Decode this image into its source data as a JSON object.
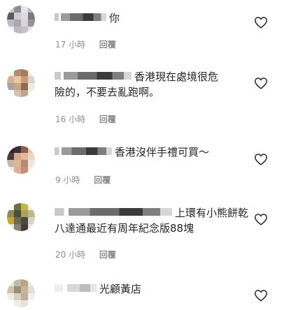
{
  "comments": [
    {
      "text": "你",
      "time": "17 小時",
      "reply": "回覆",
      "avatar": [
        "#c9c7cb",
        "#8e8d96",
        "#e6e4e8",
        "#b7b5bb",
        "#5b5a63",
        "#cfcdd2",
        "#dcdadf",
        "#7a7982",
        "#bdbbc1",
        "#a9a7ad",
        "#d7d5da",
        "#94939a",
        "#eeedf0",
        "#bcbac0",
        "#c4c2c7",
        "#e0dfe3"
      ]
    },
    {
      "text": "香港現在處境很危\n險的，不要去亂跑啊。",
      "time": "16 小時",
      "reply": "回覆",
      "avatar": [
        "#f2efe9",
        "#b68c6f",
        "#a77a5b",
        "#efeae3",
        "#d6b193",
        "#e8c6a6",
        "#c79c7a",
        "#dad3cb",
        "#a9a2a0",
        "#caa584",
        "#8f6b53",
        "#efe9e3",
        "#ffffff",
        "#d3c2b2",
        "#bca58f",
        "#f6f2ee"
      ]
    },
    {
      "text": "香港沒伴手禮可買～",
      "time": "9 小時",
      "reply": "回覆",
      "avatar": [
        "#2c2530",
        "#3d2f3a",
        "#8b5e4f",
        "#dcc8bc",
        "#4d3a3b",
        "#d7a88c",
        "#e4b89b",
        "#e9d6c8",
        "#c7b4aa",
        "#e2b597",
        "#b98b74",
        "#f1e6de",
        "#efe7e1",
        "#d5b3a0",
        "#c88d79",
        "#f4ece6"
      ]
    },
    {
      "text": "上環有小熊餅乾\n八達通最近有周年紀念版88塊",
      "time": "20 小時",
      "reply": "回覆",
      "avatar": [
        "#f4f1e6",
        "#6e6d3d",
        "#c3b744",
        "#efeadb",
        "#8c8a57",
        "#4f4d32",
        "#a9a160",
        "#bdb690",
        "#c6a533",
        "#6b6a4c",
        "#4a493f",
        "#d7d3c3",
        "#eae7dc",
        "#858170",
        "#3f3e39",
        "#e9e6df"
      ]
    },
    {
      "text": "光顧黃店",
      "time": "",
      "reply": "",
      "avatar": [
        "#e9e6e0",
        "#c4b8a6",
        "#b8a588",
        "#eee9e2",
        "#d2c3ab",
        "#9c8e7a",
        "#c7b49a",
        "#e4ddd3",
        "#f0ede8",
        "#d9cfbf",
        "#bfb09b",
        "#f3f0ec",
        "#ffffff",
        "#efebe5",
        "#e6e1da",
        "#ffffff"
      ]
    }
  ]
}
